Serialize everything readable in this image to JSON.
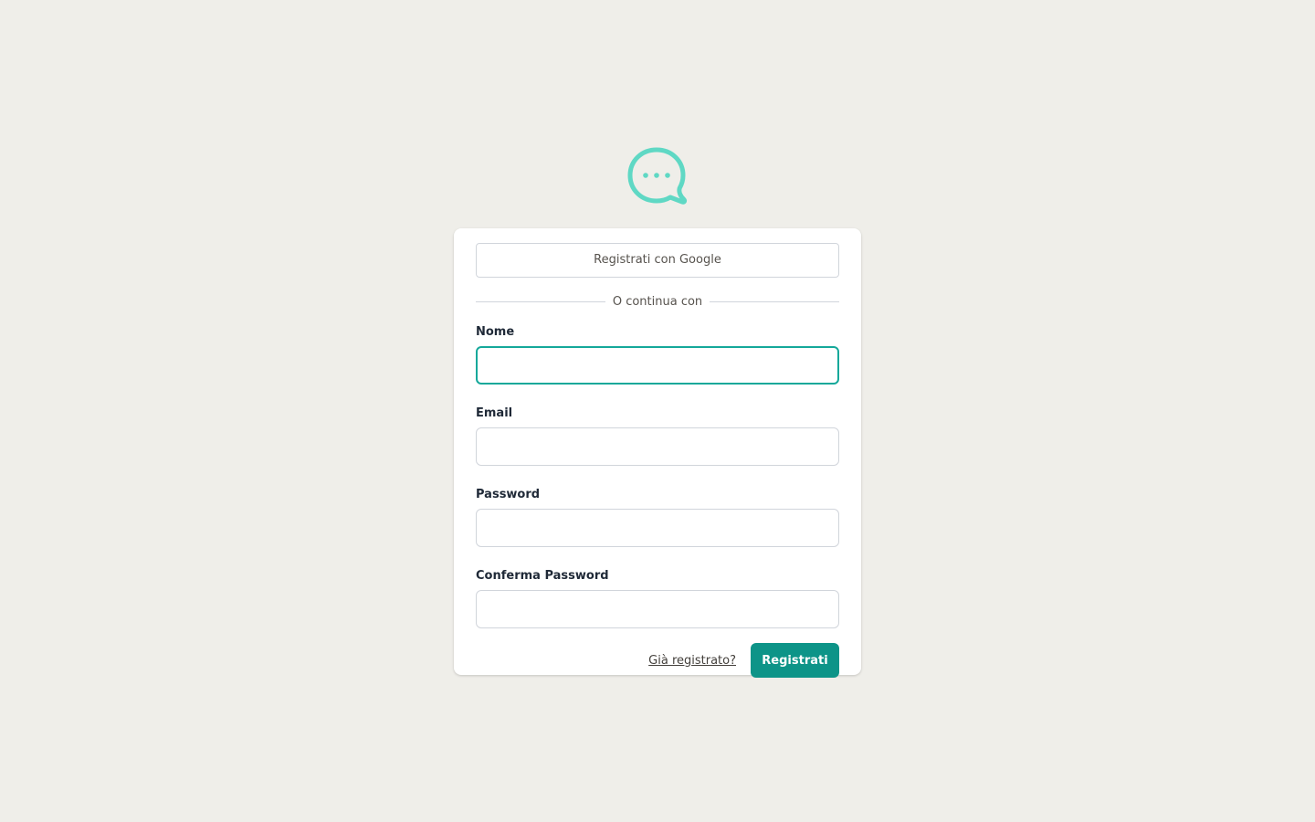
{
  "brand": {
    "logo_icon": "chat-bubble-icon",
    "logo_color": "#5fd8c4"
  },
  "signup": {
    "google_button_label": "Registrati con Google",
    "divider_text": "O continua con",
    "fields": [
      {
        "label": "Nome",
        "value": "",
        "placeholder": "",
        "focused": true
      },
      {
        "label": "Email",
        "value": "",
        "placeholder": ""
      },
      {
        "label": "Password",
        "value": "",
        "placeholder": ""
      },
      {
        "label": "Conferma Password",
        "value": "",
        "placeholder": ""
      }
    ],
    "login_link_label": "Già registrato?",
    "submit_label": "Registrati"
  },
  "colors": {
    "background": "#efeee9",
    "accent": "#0d9488",
    "focus_border": "#14a89a"
  }
}
